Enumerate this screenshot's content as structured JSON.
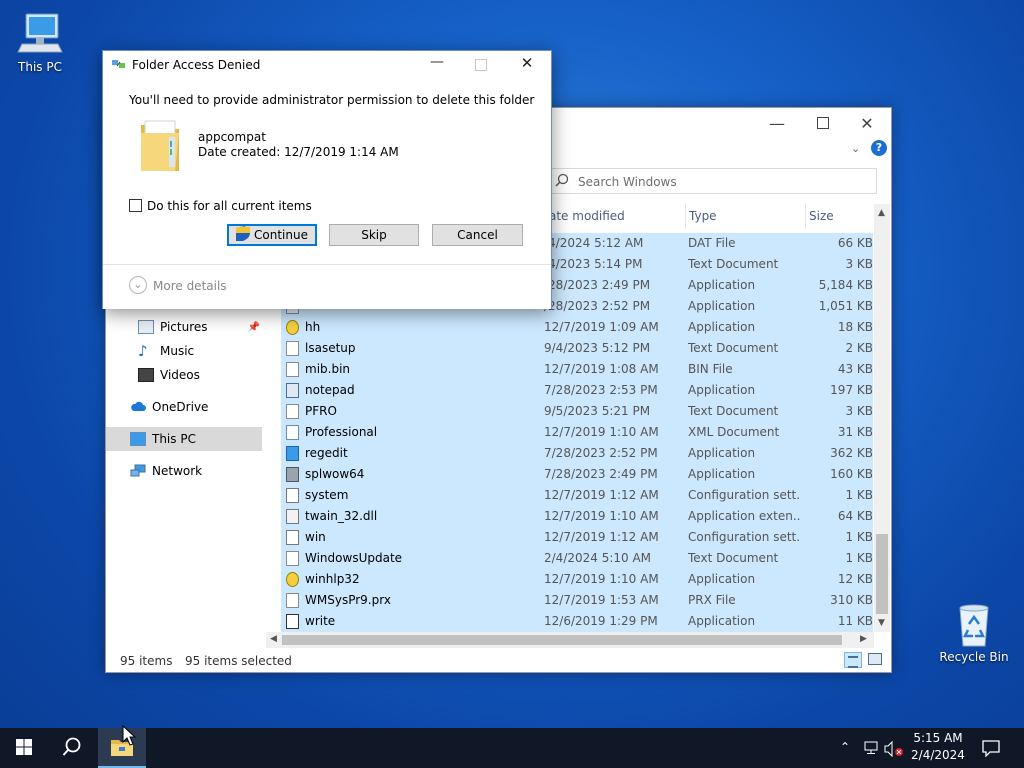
{
  "desktop": {
    "this_pc_label": "This PC",
    "recycle_bin_label": "Recycle Bin"
  },
  "explorer": {
    "search_placeholder": "Search Windows",
    "columns": {
      "date": "ate modified",
      "type": "Type",
      "size": "Size"
    },
    "nav": {
      "pictures": "Pictures",
      "music": "Music",
      "videos": "Videos",
      "onedrive": "OneDrive",
      "this_pc": "This PC",
      "network": "Network"
    },
    "rows": [
      {
        "name": "",
        "date": "/4/2024 5:12 AM",
        "type": "DAT File",
        "size": "66 KB",
        "icon": "file-icon"
      },
      {
        "name": "",
        "date": "/4/2023 5:14 PM",
        "type": "Text Document",
        "size": "3 KB",
        "icon": "file-icon"
      },
      {
        "name": "",
        "date": "/28/2023 2:49 PM",
        "type": "Application",
        "size": "5,184 KB",
        "icon": "app-icon"
      },
      {
        "name": "",
        "date": "/28/2023 2:52 PM",
        "type": "Application",
        "size": "1,051 KB",
        "icon": "app-icon"
      },
      {
        "name": "hh",
        "date": "12/7/2019 1:09 AM",
        "type": "Application",
        "size": "18 KB",
        "icon": "help-icon"
      },
      {
        "name": "lsasetup",
        "date": "9/4/2023 5:12 PM",
        "type": "Text Document",
        "size": "2 KB",
        "icon": "file-icon"
      },
      {
        "name": "mib.bin",
        "date": "12/7/2019 1:08 AM",
        "type": "BIN File",
        "size": "43 KB",
        "icon": "file-icon"
      },
      {
        "name": "notepad",
        "date": "7/28/2023 2:53 PM",
        "type": "Application",
        "size": "197 KB",
        "icon": "notepad-icon"
      },
      {
        "name": "PFRO",
        "date": "9/5/2023 5:21 PM",
        "type": "Text Document",
        "size": "3 KB",
        "icon": "file-icon"
      },
      {
        "name": "Professional",
        "date": "12/7/2019 1:10 AM",
        "type": "XML Document",
        "size": "31 KB",
        "icon": "xml-icon"
      },
      {
        "name": "regedit",
        "date": "7/28/2023 2:52 PM",
        "type": "Application",
        "size": "362 KB",
        "icon": "regedit-icon"
      },
      {
        "name": "splwow64",
        "date": "7/28/2023 2:49 PM",
        "type": "Application",
        "size": "160 KB",
        "icon": "printer-icon"
      },
      {
        "name": "system",
        "date": "12/7/2019 1:12 AM",
        "type": "Configuration sett...",
        "size": "1 KB",
        "icon": "config-icon"
      },
      {
        "name": "twain_32.dll",
        "date": "12/7/2019 1:10 AM",
        "type": "Application exten...",
        "size": "64 KB",
        "icon": "dll-icon"
      },
      {
        "name": "win",
        "date": "12/7/2019 1:12 AM",
        "type": "Configuration sett...",
        "size": "1 KB",
        "icon": "config-icon"
      },
      {
        "name": "WindowsUpdate",
        "date": "2/4/2024 5:10 AM",
        "type": "Text Document",
        "size": "1 KB",
        "icon": "file-icon"
      },
      {
        "name": "winhlp32",
        "date": "12/7/2019 1:10 AM",
        "type": "Application",
        "size": "12 KB",
        "icon": "help-icon"
      },
      {
        "name": "WMSysPr9.prx",
        "date": "12/7/2019 1:53 AM",
        "type": "PRX File",
        "size": "310 KB",
        "icon": "file-icon"
      },
      {
        "name": "write",
        "date": "12/6/2019 1:29 PM",
        "type": "Application",
        "size": "11 KB",
        "icon": "write-icon"
      }
    ],
    "status": {
      "count": "95 items",
      "selected": "95 items selected"
    }
  },
  "dialog": {
    "title": "Folder Access Denied",
    "message": "You'll need to provide administrator permission to delete this folder",
    "folder_name": "appcompat",
    "folder_date": "Date created: 12/7/2019 1:14 AM",
    "checkbox_label": "Do this for all current items",
    "continue_label": "Continue",
    "skip_label": "Skip",
    "cancel_label": "Cancel",
    "more_details_label": "More details"
  },
  "taskbar": {
    "time": "5:15 AM",
    "date": "2/4/2024"
  }
}
